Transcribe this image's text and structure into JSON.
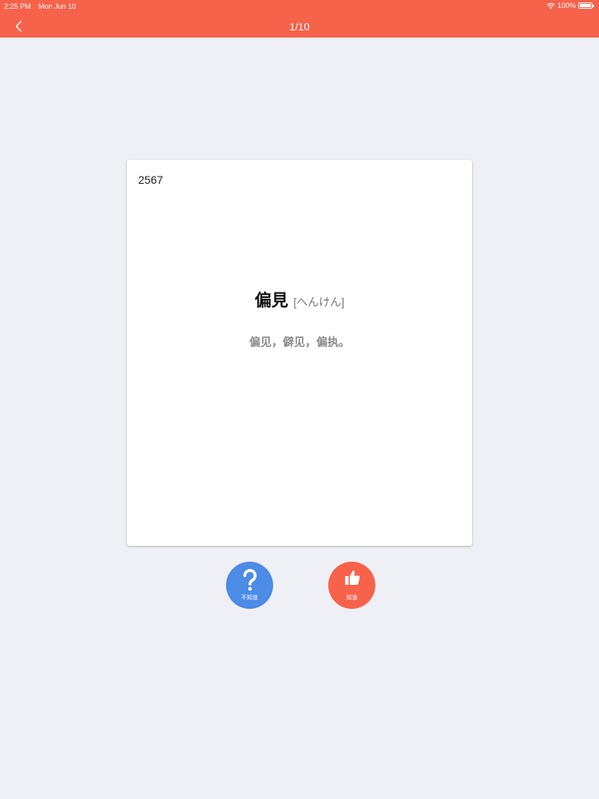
{
  "status": {
    "time": "2:25 PM",
    "date": "Mon Jun 10",
    "battery": "100%"
  },
  "nav": {
    "title": "1/10"
  },
  "card": {
    "number": "2567",
    "word": "偏見",
    "reading": "[へんけん]",
    "meaning": "偏见，僻见，偏执。"
  },
  "actions": {
    "unknown_label": "不知道",
    "known_label": "知道"
  },
  "colors": {
    "accent": "#f7624a",
    "blue": "#4c8be6",
    "background": "#eff0f5"
  }
}
